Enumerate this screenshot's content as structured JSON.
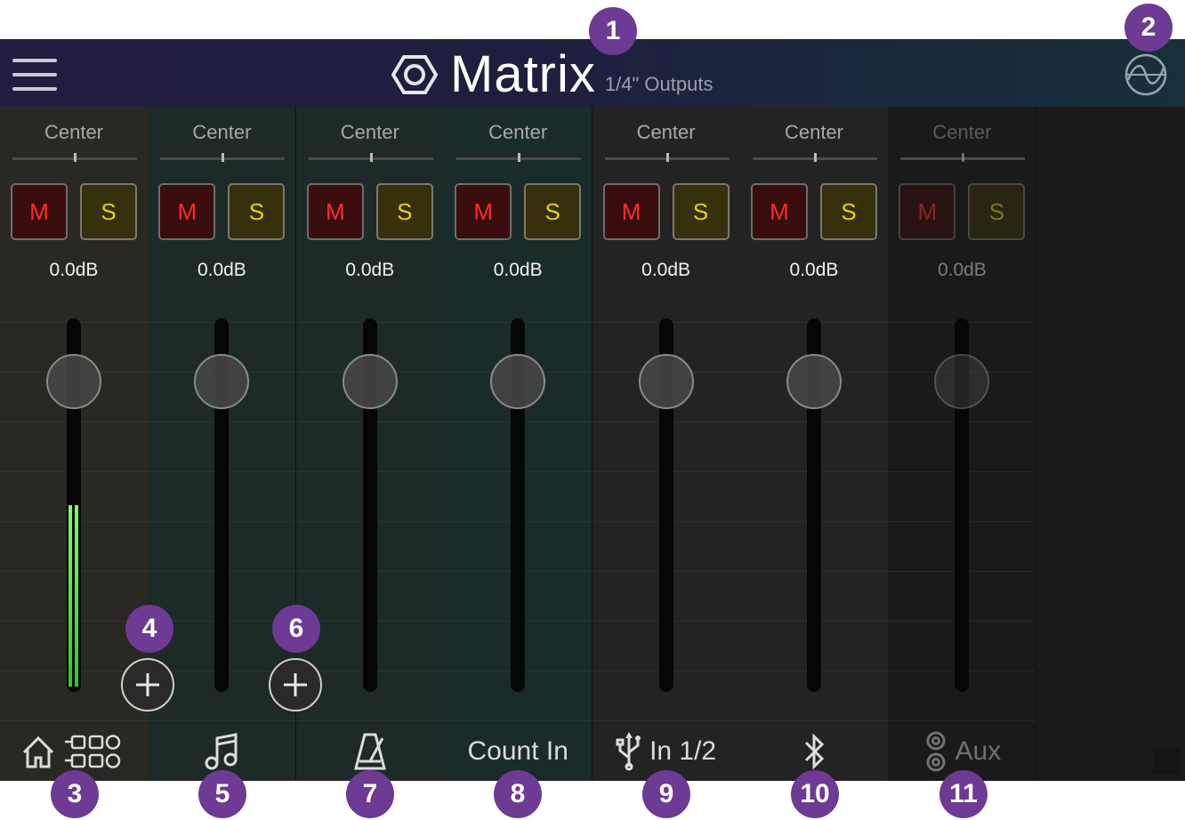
{
  "header": {
    "title": "Matrix",
    "subtitle": "1/4\" Outputs"
  },
  "channels": [
    {
      "id": "home",
      "pan": "Center",
      "mute": "M",
      "solo": "S",
      "gain": "0.0dB",
      "label": "",
      "icon": "home-matrix-icon",
      "bg": "#2a2822",
      "meter_level": 0.68
    },
    {
      "id": "playback",
      "pan": "Center",
      "mute": "M",
      "solo": "S",
      "gain": "0.0dB",
      "label": "",
      "icon": "music-note-icon",
      "bg": "#1d2a28"
    },
    {
      "id": "metronome",
      "pan": "Center",
      "mute": "M",
      "solo": "S",
      "gain": "0.0dB",
      "label": "",
      "icon": "metronome-icon",
      "bg": "#1d2a28"
    },
    {
      "id": "count-in",
      "pan": "Center",
      "mute": "M",
      "solo": "S",
      "gain": "0.0dB",
      "label": "Count In",
      "icon": "",
      "bg": "#1b2b29"
    },
    {
      "id": "usb",
      "pan": "Center",
      "mute": "M",
      "solo": "S",
      "gain": "0.0dB",
      "label": "In 1/2",
      "icon": "usb-icon",
      "bg": "#232323"
    },
    {
      "id": "bluetooth",
      "pan": "Center",
      "mute": "M",
      "solo": "S",
      "gain": "0.0dB",
      "label": "",
      "icon": "bluetooth-icon",
      "bg": "#232323"
    },
    {
      "id": "aux",
      "pan": "Center",
      "mute": "M",
      "solo": "S",
      "gain": "0.0dB",
      "label": "Aux",
      "icon": "aux-jack-icon",
      "bg": "#1a1a1a",
      "dimmed": true
    }
  ],
  "callouts": [
    "1",
    "2",
    "3",
    "4",
    "5",
    "6",
    "7",
    "8",
    "9",
    "10",
    "11"
  ],
  "colors": {
    "accent_callout": "#6d3a94",
    "mute": "#ff2a2a",
    "solo": "#e6cf1a",
    "meter": "#3fe03a"
  }
}
